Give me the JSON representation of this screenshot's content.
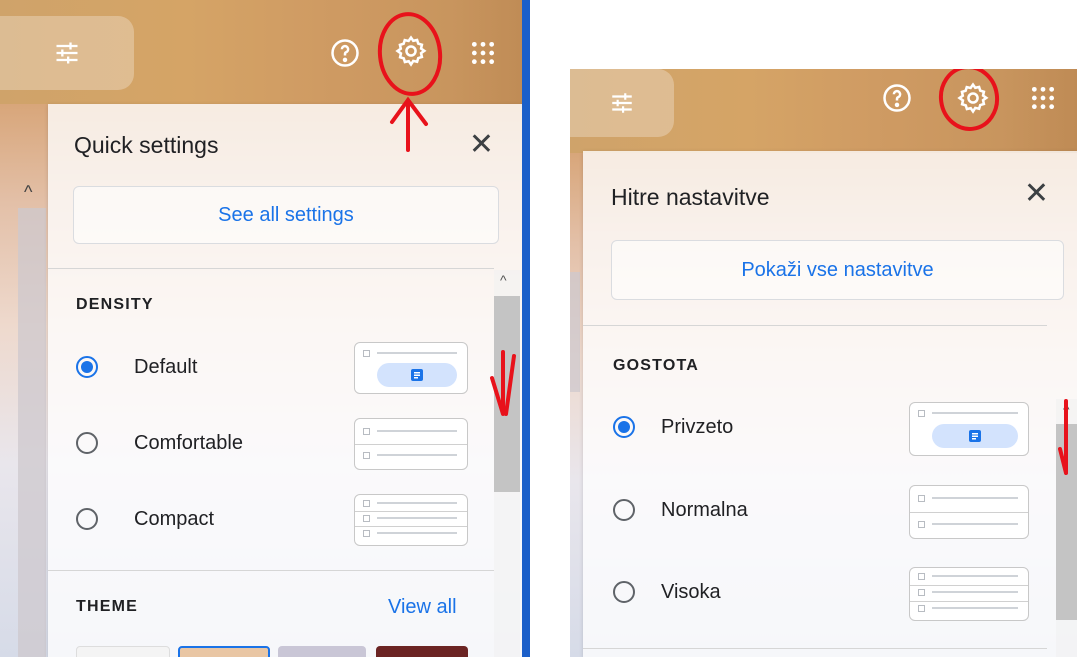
{
  "left": {
    "panel_title": "Quick settings",
    "close_label": "✕",
    "see_all_label": "See all settings",
    "density_label": "DENSITY",
    "theme_label": "THEME",
    "view_all_label": "View all",
    "options": [
      {
        "label": "Default",
        "checked": true
      },
      {
        "label": "Comfortable",
        "checked": false
      },
      {
        "label": "Compact",
        "checked": false
      }
    ]
  },
  "right": {
    "panel_title": "Hitre nastavitve",
    "close_label": "✕",
    "see_all_label": "Pokaži vse nastavitve",
    "density_label": "GOSTOTA",
    "options": [
      {
        "label": "Privzeto",
        "checked": true
      },
      {
        "label": "Normalna",
        "checked": false
      },
      {
        "label": "Visoka",
        "checked": false
      }
    ]
  },
  "icons": {
    "filter": "tune-icon",
    "help": "help-icon",
    "settings": "gear-icon",
    "apps": "apps-grid-icon",
    "close": "close-icon"
  },
  "colors": {
    "accent": "#1a73e8",
    "annotation": "#e8121b",
    "chip": "#d3e3fd"
  }
}
